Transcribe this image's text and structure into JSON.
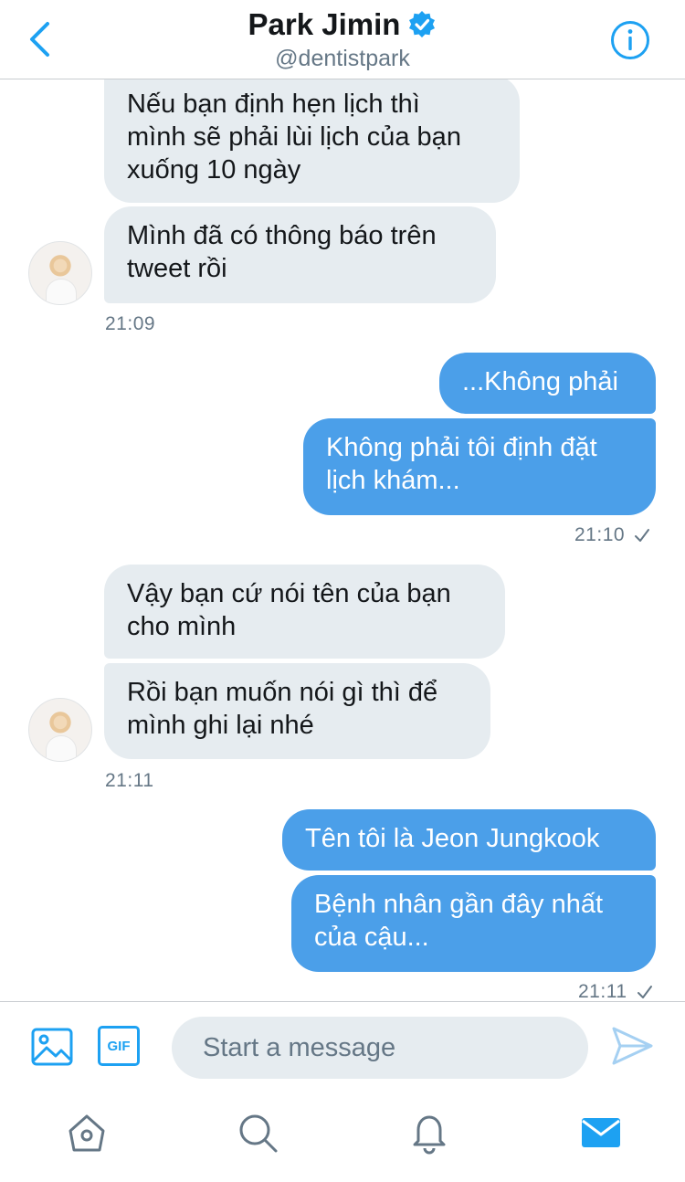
{
  "header": {
    "name": "Park Jimin",
    "handle": "@dentistpark",
    "verified": true
  },
  "messages": [
    {
      "side": "in",
      "text": "Nếu bạn định hẹn lịch thì\nmình sẽ phải lùi lịch của bạn\nxuống 10 ngày"
    },
    {
      "side": "in",
      "text": "Mình đã có thông báo trên\ntweet rồi"
    },
    {
      "side": "in_time",
      "text": "21:09"
    },
    {
      "side": "out",
      "text": "...Không phải"
    },
    {
      "side": "out",
      "text": "Không phải tôi định đặt\nlịch khám..."
    },
    {
      "side": "out_time",
      "text": "21:10"
    },
    {
      "side": "in",
      "text": "Vậy bạn cứ nói tên của bạn\ncho mình"
    },
    {
      "side": "in",
      "text": "Rồi bạn muốn nói gì thì để\nmình ghi lại nhé"
    },
    {
      "side": "in_time",
      "text": "21:11"
    },
    {
      "side": "out",
      "text": "Tên tôi là Jeon Jungkook"
    },
    {
      "side": "out",
      "text": "Bệnh nhân gần đây nhất\ncủa cậu..."
    },
    {
      "side": "out_time",
      "text": "21:11"
    }
  ],
  "composer": {
    "placeholder": "Start a message",
    "gif_label": "GIF"
  },
  "icons": {
    "back": "chevron-left-icon",
    "info": "info-icon",
    "media": "image-icon",
    "send": "send-icon",
    "tabs": [
      "home-icon",
      "search-icon",
      "notifications-icon",
      "mail-icon"
    ]
  },
  "colors": {
    "accent": "#1da1f2",
    "outgoing_bubble": "#4b9fe9",
    "incoming_bubble": "#e6ecf0",
    "muted_text": "#657786"
  }
}
